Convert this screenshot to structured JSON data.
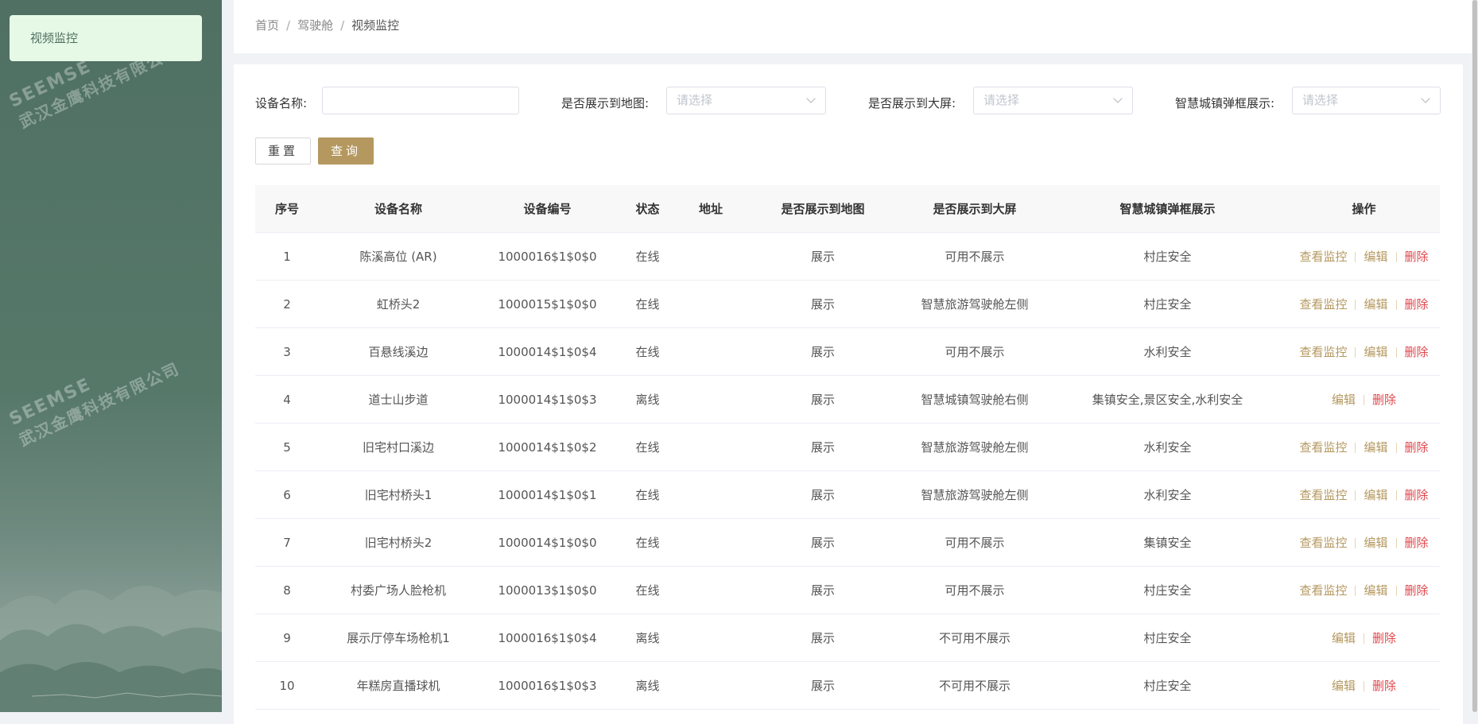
{
  "sidebar": {
    "menu": [
      {
        "label": "视频监控"
      }
    ],
    "watermark": {
      "line1": "SEEMSE",
      "line2": "武汉金鹰科技有限公司"
    }
  },
  "breadcrumb": [
    "首页",
    "驾驶舱",
    "视频监控"
  ],
  "filters": {
    "device_name": {
      "label": "设备名称:",
      "value": ""
    },
    "show_map": {
      "label": "是否展示到地图:",
      "placeholder": "请选择"
    },
    "show_screen": {
      "label": "是否展示到大屏:",
      "placeholder": "请选择"
    },
    "popup": {
      "label": "智慧城镇弹框展示:",
      "placeholder": "请选择"
    }
  },
  "buttons": {
    "reset": "重置",
    "query": "查询"
  },
  "table": {
    "headers": [
      "序号",
      "设备名称",
      "设备编号",
      "状态",
      "地址",
      "是否展示到地图",
      "是否展示到大屏",
      "智慧城镇弹框展示",
      "操作"
    ],
    "actions": {
      "view": "查看监控",
      "edit": "编辑",
      "delete": "删除"
    },
    "rows": [
      {
        "no": "1",
        "name": "陈溪高位 (AR)",
        "code": "1000016$1$0$0",
        "status": "在线",
        "addr": "",
        "map": "展示",
        "screen": "可用不展示",
        "popup": "村庄安全",
        "view": true
      },
      {
        "no": "2",
        "name": "虹桥头2",
        "code": "1000015$1$0$0",
        "status": "在线",
        "addr": "",
        "map": "展示",
        "screen": "智慧旅游驾驶舱左侧",
        "popup": "村庄安全",
        "view": true
      },
      {
        "no": "3",
        "name": "百悬线溪边",
        "code": "1000014$1$0$4",
        "status": "在线",
        "addr": "",
        "map": "展示",
        "screen": "可用不展示",
        "popup": "水利安全",
        "view": true
      },
      {
        "no": "4",
        "name": "道士山步道",
        "code": "1000014$1$0$3",
        "status": "离线",
        "addr": "",
        "map": "展示",
        "screen": "智慧城镇驾驶舱右侧",
        "popup": "集镇安全,景区安全,水利安全",
        "view": false
      },
      {
        "no": "5",
        "name": "旧宅村口溪边",
        "code": "1000014$1$0$2",
        "status": "在线",
        "addr": "",
        "map": "展示",
        "screen": "智慧旅游驾驶舱左侧",
        "popup": "水利安全",
        "view": true
      },
      {
        "no": "6",
        "name": "旧宅村桥头1",
        "code": "1000014$1$0$1",
        "status": "在线",
        "addr": "",
        "map": "展示",
        "screen": "智慧旅游驾驶舱左侧",
        "popup": "水利安全",
        "view": true
      },
      {
        "no": "7",
        "name": "旧宅村桥头2",
        "code": "1000014$1$0$0",
        "status": "在线",
        "addr": "",
        "map": "展示",
        "screen": "可用不展示",
        "popup": "集镇安全",
        "view": true
      },
      {
        "no": "8",
        "name": "村委广场人脸枪机",
        "code": "1000013$1$0$0",
        "status": "在线",
        "addr": "",
        "map": "展示",
        "screen": "可用不展示",
        "popup": "村庄安全",
        "view": true
      },
      {
        "no": "9",
        "name": "展示厅停车场枪机1",
        "code": "1000016$1$0$4",
        "status": "离线",
        "addr": "",
        "map": "展示",
        "screen": "不可用不展示",
        "popup": "村庄安全",
        "view": false
      },
      {
        "no": "10",
        "name": "年糕房直播球机",
        "code": "1000016$1$0$3",
        "status": "离线",
        "addr": "",
        "map": "展示",
        "screen": "不可用不展示",
        "popup": "村庄安全",
        "view": false
      }
    ]
  },
  "colors": {
    "sidebar": "#567869",
    "accent": "#b4985f",
    "danger": "#e0474c",
    "menu_active": "#e6f8e6"
  }
}
